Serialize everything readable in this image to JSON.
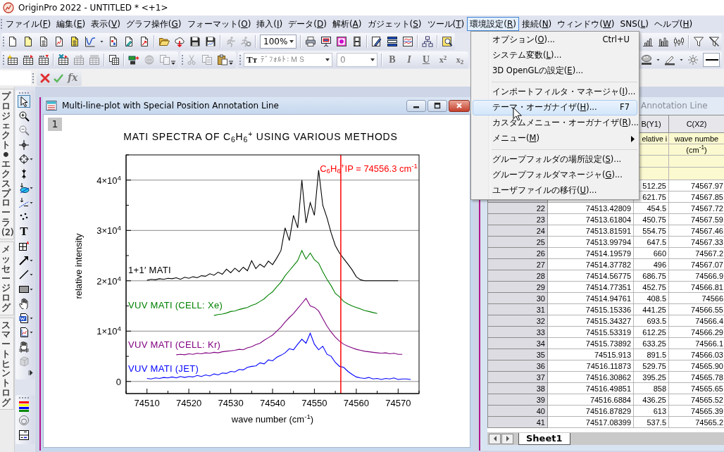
{
  "title_bar": {
    "title": "OriginPro 2022 - UNTITLED * <+1>"
  },
  "menu_bar": [
    {
      "label": "ファイル(F)",
      "selected": false
    },
    {
      "label": "編集(E)",
      "selected": false
    },
    {
      "label": "表示(V)",
      "selected": false
    },
    {
      "label": "グラフ操作(G)",
      "selected": false
    },
    {
      "label": "フォーマット(O)",
      "selected": false
    },
    {
      "label": "挿入(I)",
      "selected": false
    },
    {
      "label": "データ(D)",
      "selected": false
    },
    {
      "label": "解析(A)",
      "selected": false
    },
    {
      "label": "ガジェット(S)",
      "selected": false
    },
    {
      "label": "ツール(T)",
      "selected": false
    },
    {
      "label": "環境設定(R)",
      "selected": true
    },
    {
      "label": "接続(N)",
      "selected": false
    },
    {
      "label": "ウィンドウ(W)",
      "selected": false
    },
    {
      "label": "SNS(L)",
      "selected": false
    },
    {
      "label": "ヘルプ(H)",
      "selected": false
    }
  ],
  "toolbar_1": {
    "bands": [
      [
        [
          {
            "kind": "button",
            "disabled": false
          },
          {
            "kind": "button",
            "disabled": false
          },
          {
            "kind": "button",
            "disabled": false
          },
          {
            "kind": "button",
            "disabled": false
          },
          {
            "kind": "button",
            "disabled": false
          },
          {
            "kind": "button",
            "disabled": false
          },
          {
            "kind": "button",
            "disabled": false
          },
          {
            "kind": "button",
            "disabled": false
          },
          {
            "kind": "button",
            "disabled": false
          }
        ],
        [
          {
            "kind": "button",
            "disabled": false
          },
          {
            "kind": "button",
            "disabled": false
          },
          {
            "kind": "button",
            "disabled": false
          },
          {
            "kind": "button",
            "disabled": false
          }
        ],
        [
          {
            "kind": "button",
            "disabled": true
          },
          {
            "kind": "button",
            "disabled": true
          }
        ],
        [
          {
            "kind": "combo",
            "value": "100%",
            "disabled": false
          }
        ],
        [
          {
            "kind": "button",
            "disabled": false
          },
          {
            "kind": "button",
            "disabled": false
          },
          {
            "kind": "button",
            "disabled": false
          },
          {
            "kind": "button",
            "disabled": false
          }
        ],
        [
          {
            "kind": "button",
            "disabled": false
          },
          {
            "kind": "button",
            "disabled": false
          },
          {
            "kind": "button",
            "disabled": false
          }
        ],
        [
          {
            "kind": "button",
            "disabled": false
          }
        ],
        [
          {
            "kind": "button",
            "disabled": false
          }
        ]
      ]
    ],
    "right_bands": [
      [
        [
          {
            "kind": "button",
            "disabled": false
          },
          {
            "kind": "button",
            "disabled": false
          },
          {
            "kind": "button",
            "disabled": false
          }
        ],
        [
          {
            "kind": "button",
            "disabled": false
          },
          {
            "kind": "button",
            "disabled": false
          }
        ]
      ]
    ]
  },
  "toolbar_2": {
    "bands": [
      [
        [
          {
            "kind": "button",
            "disabled": false
          },
          {
            "kind": "button",
            "disabled": false
          },
          {
            "kind": "button",
            "disabled": false
          }
        ],
        [
          {
            "kind": "button",
            "disabled": false
          },
          {
            "kind": "button",
            "disabled": true
          },
          {
            "kind": "button",
            "disabled": true
          }
        ],
        [
          {
            "kind": "button",
            "disabled": false
          }
        ],
        [
          {
            "kind": "button",
            "disabled": false
          },
          {
            "kind": "button",
            "disabled": true
          },
          {
            "kind": "button",
            "disabled": true
          }
        ]
      ],
      [
        [
          {
            "kind": "button",
            "disabled": true
          },
          {
            "kind": "button",
            "disabled": true
          },
          {
            "kind": "button",
            "disabled": false
          }
        ]
      ],
      [
        [
          {
            "kind": "font_combo",
            "icon_text": "Tт",
            "value": "ﾃﾞﾌｫﾙﾄ：ＭＳ",
            "disabled": true
          },
          {
            "kind": "combo",
            "value": "0",
            "disabled": true
          }
        ],
        [
          {
            "kind": "text_button",
            "label": "B",
            "disabled": true
          },
          {
            "kind": "text_button",
            "label": "I",
            "disabled": true
          },
          {
            "kind": "text_button",
            "label": "U",
            "disabled": true
          },
          {
            "kind": "text_button",
            "label": "x$^{2}$",
            "disabled": true
          },
          {
            "kind": "text_button",
            "label": "x$_{2}$",
            "disabled": true
          }
        ]
      ]
    ],
    "right_bands": [
      [
        [
          {
            "kind": "button",
            "disabled": false
          },
          {
            "kind": "button",
            "disabled": false
          },
          {
            "kind": "button",
            "disabled": false
          },
          {
            "kind": "line_combo",
            "disabled": false
          }
        ]
      ]
    ]
  },
  "formula_bar": {
    "fx": "fx"
  },
  "side_tabs": [
    {
      "label": "プロジェクト・エクスプローラ (2)",
      "selected": false
    },
    {
      "label": "メッセージログ",
      "selected": false
    },
    {
      "label": "スマートヒントログ",
      "selected": false
    }
  ],
  "tools": [
    {
      "selected": true,
      "disabled": false
    },
    {
      "selected": false,
      "disabled": false
    },
    {
      "selected": false,
      "disabled": true
    },
    {
      "selected": false,
      "disabled": false
    },
    {
      "selected": false,
      "disabled": false
    },
    {
      "selected": false,
      "disabled": false
    },
    {
      "selected": false,
      "disabled": false
    },
    {
      "selected": false,
      "disabled": false
    },
    {
      "selected": false,
      "disabled": false
    },
    {
      "label": "T",
      "selected": false,
      "disabled": false
    },
    {
      "selected": false,
      "disabled": false
    },
    {
      "selected": false,
      "disabled": false
    },
    {
      "selected": false,
      "disabled": false
    },
    {
      "selected": false,
      "disabled": false
    },
    {
      "selected": false,
      "disabled": false
    },
    {
      "selected": false,
      "disabled": false
    },
    {
      "selected": false,
      "disabled": false
    },
    {
      "selected": false,
      "disabled": false
    },
    {
      "selected": false,
      "disabled": true
    }
  ],
  "tools_2": [
    {
      "disabled": false
    },
    {
      "disabled": false
    },
    {
      "disabled": false
    }
  ],
  "graph_window": {
    "title": "Multi-line-plot with Special Position Annotation Line",
    "layer": "1",
    "chart_data": {
      "type": "line",
      "title": "MATI SPECTRA OF C$_{6}$H$_{6}$$^{+}$ USING VARIOUS METHODS",
      "xlabel": "wave number (cm$^{-1}$)",
      "ylabel": "relative intensity",
      "xlim": [
        74505,
        74575
      ],
      "ylim": [
        -2400,
        45000
      ],
      "grid": true,
      "xticks": [
        74510,
        74520,
        74530,
        74540,
        74550,
        74560,
        74570
      ],
      "yticks": [
        {
          "value": 0,
          "label": "0"
        },
        {
          "value": 10000,
          "label": "1×10$^{4}$"
        },
        {
          "value": 20000,
          "label": "2×10$^{4}$"
        },
        {
          "value": 30000,
          "label": "3×10$^{4}$"
        },
        {
          "value": 40000,
          "label": "4×10$^{4}$"
        }
      ],
      "x": [
        74510,
        74511,
        74512,
        74513,
        74514,
        74515,
        74516,
        74517,
        74518,
        74519,
        74520,
        74521,
        74522,
        74523,
        74524,
        74525,
        74526,
        74527,
        74528,
        74529,
        74530,
        74531,
        74532,
        74533,
        74534,
        74535,
        74536,
        74537,
        74538,
        74539,
        74540,
        74541,
        74542,
        74543,
        74544,
        74545,
        74546,
        74547,
        74548,
        74549,
        74550,
        74551,
        74552,
        74553,
        74554,
        74555,
        74556,
        74557,
        74558,
        74559,
        74560,
        74561,
        74562,
        74563,
        74564,
        74565,
        74566,
        74567,
        74568,
        74569,
        74570,
        74571,
        74572,
        74573
      ],
      "series": [
        {
          "name": "1+1′ MATI",
          "color": "#000000",
          "values": [
            20100,
            20300,
            20200,
            20400,
            20300,
            20500,
            20400,
            20600,
            20300,
            20700,
            20500,
            20800,
            20600,
            21000,
            20900,
            21400,
            21100,
            21700,
            21300,
            22300,
            21600,
            22500,
            21800,
            22700,
            22000,
            24000,
            22400,
            23300,
            22700,
            23900,
            23200,
            24500,
            26000,
            30500,
            28000,
            33000,
            30500,
            40000,
            31500,
            35500,
            33000,
            42000,
            35000,
            32500,
            29500,
            27000,
            25500,
            24400,
            23300,
            22200,
            20800,
            20200,
            20000,
            20000,
            20000,
            20000,
            20000,
            20000,
            20000,
            20000,
            20000,
            null,
            null,
            null
          ]
        },
        {
          "name": "VUV MATI (CELL:  Xe)",
          "color": "#008000",
          "values": [
            null,
            null,
            null,
            null,
            null,
            null,
            null,
            null,
            null,
            null,
            null,
            null,
            null,
            null,
            null,
            null,
            13100,
            13300,
            13400,
            13600,
            13900,
            14000,
            14300,
            14500,
            14700,
            15100,
            15400,
            15900,
            16400,
            17200,
            17800,
            18800,
            19700,
            21000,
            22000,
            23000,
            24000,
            26000,
            24300,
            25500,
            24200,
            23500,
            21800,
            20300,
            19000,
            17500,
            16800,
            15900,
            15400,
            15000,
            14700,
            14400,
            14100,
            13900,
            13700,
            13500,
            null,
            null,
            null,
            null,
            null,
            null,
            null,
            null
          ]
        },
        {
          "name": "VUV MATI (CELL:  Kr)",
          "color": "#800080",
          "values": [
            null,
            null,
            null,
            null,
            null,
            null,
            null,
            5300,
            5400,
            5300,
            5500,
            5400,
            5600,
            5500,
            5700,
            5600,
            5800,
            5700,
            5900,
            6000,
            6100,
            6200,
            6400,
            6300,
            6700,
            6900,
            7300,
            7600,
            8200,
            8700,
            9200,
            10000,
            10800,
            11800,
            12700,
            13500,
            14500,
            15500,
            16500,
            15000,
            14700,
            14000,
            12500,
            11000,
            9800,
            8800,
            8000,
            7400,
            7000,
            6700,
            6400,
            6200,
            6000,
            5900,
            5800,
            5700,
            5600,
            5700,
            5500,
            5600,
            5400,
            5400,
            null,
            null
          ]
        },
        {
          "name": "VUV MATI (JET)",
          "color": "#0000ff",
          "values": [
            600,
            500,
            700,
            600,
            800,
            700,
            900,
            700,
            1000,
            800,
            1000,
            900,
            1200,
            1000,
            1300,
            1100,
            1500,
            1300,
            1700,
            1600,
            2000,
            1900,
            2400,
            2300,
            2800,
            3000,
            3100,
            3700,
            3500,
            4300,
            4100,
            4800,
            5200,
            5700,
            6500,
            6300,
            7400,
            8400,
            7600,
            9600,
            7400,
            6300,
            7000,
            5400,
            5000,
            3800,
            3000,
            2800,
            2000,
            1400,
            900,
            700,
            600,
            800,
            500,
            600,
            400,
            600,
            500,
            700,
            400,
            500,
            500,
            400
          ]
        }
      ],
      "ref_lines": [
        {
          "axis": "x",
          "value": 74556.3,
          "color": "#ff0000"
        }
      ],
      "annotations": [
        "C$_{6}$H$_{6}$$^{+}$IP = 74556.3 cm$^{-1}$"
      ]
    }
  },
  "worksheet": {
    "title": "Annotation Line",
    "col_b": {
      "header": "B(Y1)",
      "long_name": "elative i"
    },
    "col_c": {
      "header": "C(X2)",
      "long_name": "wave numbe",
      "units": "(cm$^{-1}$)"
    },
    "rows": [
      {
        "b": "512.25",
        "c": "74567.97"
      },
      {
        "b": "621.75",
        "c": "74567.85"
      },
      {
        "row": "22",
        "a": "74513.42809",
        "b": "454.5",
        "c": "74567.72"
      },
      {
        "row": "23",
        "a": "74513.61804",
        "b": "450.75",
        "c": "74567.59"
      },
      {
        "row": "24",
        "a": "74513.81591",
        "b": "554.75",
        "c": "74567.46"
      },
      {
        "row": "25",
        "a": "74513.99794",
        "b": "647.5",
        "c": "74567.33"
      },
      {
        "row": "26",
        "a": "74514.19579",
        "b": "660",
        "c": "74567.2"
      },
      {
        "row": "27",
        "a": "74514.37782",
        "b": "496",
        "c": "74567.07"
      },
      {
        "row": "28",
        "a": "74514.56775",
        "b": "686.75",
        "c": "74566.9"
      },
      {
        "row": "29",
        "a": "74514.77351",
        "b": "452.75",
        "c": "74566.81"
      },
      {
        "row": "30",
        "a": "74514.94761",
        "b": "408.5",
        "c": "74566"
      },
      {
        "row": "31",
        "a": "74515.15336",
        "b": "441.25",
        "c": "74566.55"
      },
      {
        "row": "32",
        "a": "74515.34327",
        "b": "693.5",
        "c": "74566.4"
      },
      {
        "row": "33",
        "a": "74515.53319",
        "b": "612.25",
        "c": "74566.29"
      },
      {
        "row": "34",
        "a": "74515.73892",
        "b": "633.25",
        "c": "74566.1"
      },
      {
        "row": "35",
        "a": "74515.913",
        "b": "891.5",
        "c": "74566.03"
      },
      {
        "row": "36",
        "a": "74516.11873",
        "b": "529.75",
        "c": "74565.90"
      },
      {
        "row": "37",
        "a": "74516.30862",
        "b": "395.25",
        "c": "74565.78"
      },
      {
        "row": "38",
        "a": "74516.49851",
        "b": "858",
        "c": "74565.65"
      },
      {
        "row": "39",
        "a": "74516.6884",
        "b": "436.25",
        "c": "74565.52"
      },
      {
        "row": "40",
        "a": "74516.87829",
        "b": "613",
        "c": "74565.39"
      },
      {
        "row": "41",
        "a": "74517.08399",
        "b": "537.5",
        "c": "74565.2"
      }
    ],
    "sheet_tab": {
      "label": "Sheet1",
      "selected": true
    }
  },
  "dropdown_menu": {
    "items": [
      {
        "kind": "item",
        "label": "オプション(O)...",
        "shortcut": "Ctrl+U",
        "selected": false,
        "submenu": false
      },
      {
        "kind": "item",
        "label": "システム変数(L)...",
        "selected": false,
        "submenu": false
      },
      {
        "kind": "item",
        "label": "3D OpenGLの設定(E)...",
        "selected": false,
        "submenu": false
      },
      {
        "kind": "separator"
      },
      {
        "kind": "item",
        "label": "インポートフィルタ・マネージャ(I)...",
        "selected": false,
        "submenu": false
      },
      {
        "kind": "item",
        "label": "テーマ・オーガナイザ(H)...",
        "shortcut": "F7",
        "selected": true,
        "submenu": false
      },
      {
        "kind": "item",
        "label": "カスタムメニュー・オーガナイザ(R)...",
        "selected": false,
        "submenu": false
      },
      {
        "kind": "item",
        "label": "メニュー(M)",
        "selected": false,
        "submenu": true
      },
      {
        "kind": "separator"
      },
      {
        "kind": "item",
        "label": "グループフォルダの場所設定(S)...",
        "selected": false,
        "submenu": false
      },
      {
        "kind": "item",
        "label": "グループフォルダマネージャ(G)...",
        "selected": false,
        "submenu": false
      },
      {
        "kind": "item",
        "label": "ユーザファイルの移行(U)...",
        "selected": false,
        "submenu": false
      }
    ]
  }
}
